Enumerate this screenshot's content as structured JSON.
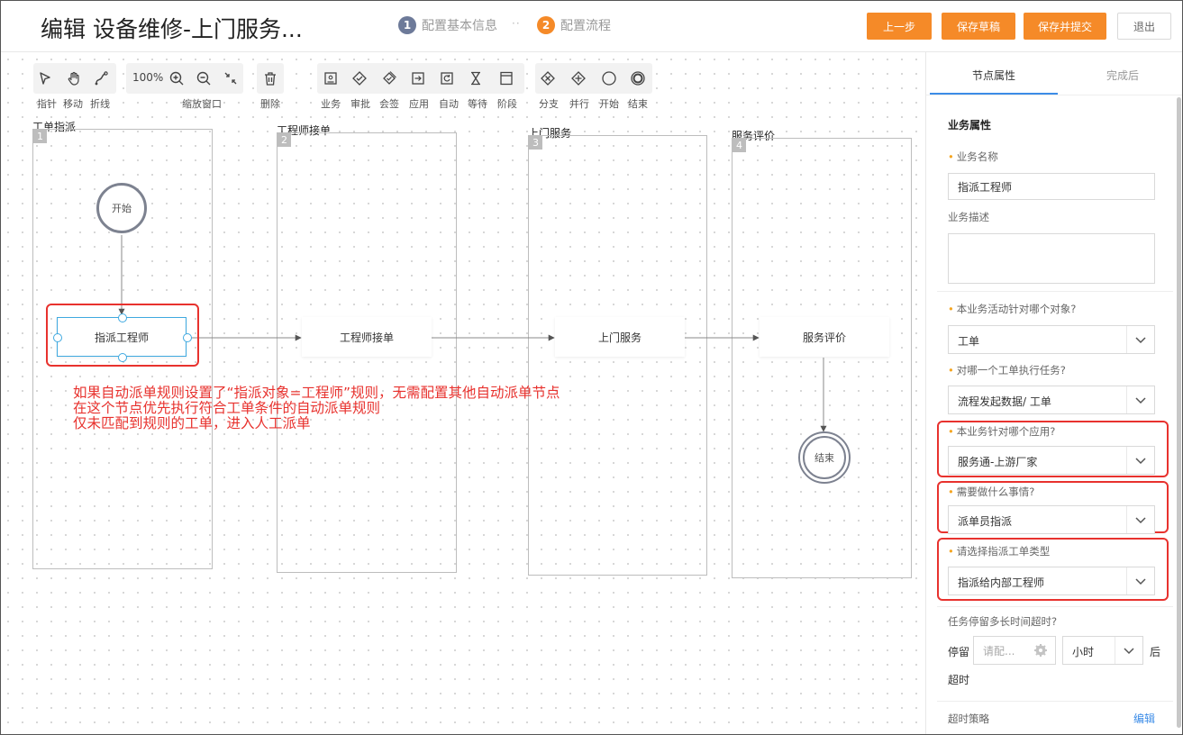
{
  "header": {
    "title": "编辑 设备维修-上门服务...",
    "steps": [
      {
        "num": "1",
        "label": "配置基本信息"
      },
      {
        "num": "2",
        "label": "配置流程"
      }
    ],
    "separator": "··",
    "buttons": {
      "prev": "上一步",
      "save_draft": "保存草稿",
      "save_submit": "保存并提交",
      "exit": "退出"
    }
  },
  "toolbar": {
    "zoom": "100%",
    "labels": {
      "pointer": "指针",
      "move": "移动",
      "polyline": "折线",
      "zoom_window": "缩放窗口",
      "delete": "删除",
      "business": "业务",
      "approve": "审批",
      "countersign": "会签",
      "apply": "应用",
      "auto": "自动",
      "wait": "等待",
      "stage": "阶段",
      "branch": "分支",
      "parallel": "并行",
      "start": "开始",
      "end": "结束"
    }
  },
  "lanes": [
    {
      "num": "1",
      "title": "工单指派"
    },
    {
      "num": "2",
      "title": "工程师接单"
    },
    {
      "num": "3",
      "title": "上门服务"
    },
    {
      "num": "4",
      "title": "服务评价"
    }
  ],
  "nodes": {
    "start": "开始",
    "dispatch": "指派工程师",
    "accept": "工程师接单",
    "onsite": "上门服务",
    "review": "服务评价",
    "end": "结束"
  },
  "annotation": [
    "如果自动派单规则设置了“指派对象=工程师”规则，无需配置其他自动派单节点",
    "在这个节点优先执行符合工单条件的自动派单规则",
    "仅未匹配到规则的工单，进入人工派单"
  ],
  "panel": {
    "tabs": {
      "props": "节点属性",
      "after": "完成后"
    },
    "section_title": "业务属性",
    "name_label": "业务名称",
    "name_value": "指派工程师",
    "desc_label": "业务描述",
    "object_label": "本业务活动针对哪个对象?",
    "object_value": "工单",
    "task_label": "对哪一个工单执行任务?",
    "task_value": "流程发起数据/ 工单",
    "app_label": "本业务针对哪个应用?",
    "app_value": "服务通-上游厂家",
    "action_label": "需要做什么事情?",
    "action_value": "派单员指派",
    "dispatch_type_label": "请选择指派工单类型",
    "dispatch_type_value": "指派给内部工程师",
    "timeout_label": "任务停留多长时间超时?",
    "stay_label": "停留",
    "stay_placeholder": "请配...",
    "unit_value": "小时",
    "after_label": "后",
    "timeout_suffix": "超时",
    "policy_label": "超时策略",
    "edit_link": "编辑"
  },
  "colors": {
    "accent_orange": "#f58a28",
    "link_blue": "#3c8ce7",
    "highlight_red": "#e8322e",
    "selection_blue": "#3fa9e0"
  }
}
